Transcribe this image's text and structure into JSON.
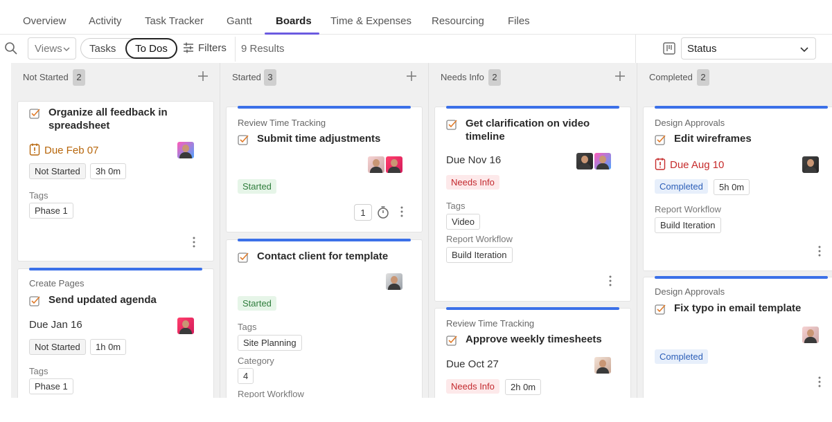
{
  "tabs": [
    "Overview",
    "Activity",
    "Task Tracker",
    "Gantt",
    "Boards",
    "Time & Expenses",
    "Resourcing",
    "Files"
  ],
  "active_tab": "Boards",
  "toolbar": {
    "views_label": "Views",
    "seg_tasks": "Tasks",
    "seg_todos": "To Dos",
    "filters_label": "Filters",
    "results": "9 Results",
    "group_by": "Status"
  },
  "colors": {
    "accent": "#6b5ae0",
    "card_bar": "#3b70e8"
  },
  "columns": [
    {
      "title": "Not Started",
      "count": "2"
    },
    {
      "title": "Started",
      "count": "3"
    },
    {
      "title": "Needs Info",
      "count": "2"
    },
    {
      "title": "Completed",
      "count": "2"
    }
  ],
  "labels": {
    "tags": "Tags",
    "report_workflow": "Report Workflow",
    "category": "Category"
  },
  "cards": {
    "c1": {
      "title": "Organize all feedback in spreadsheet",
      "due": "Due Feb 07",
      "status": "Not Started",
      "time": "3h 0m",
      "tag": "Phase 1"
    },
    "c2": {
      "parent": "Create Pages",
      "title": "Send updated agenda",
      "due": "Due Jan 16",
      "status": "Not Started",
      "time": "1h 0m",
      "tag": "Phase 1"
    },
    "c3": {
      "parent": "Review Time Tracking",
      "title": "Submit time adjustments",
      "status": "Started",
      "comment_count": "1"
    },
    "c4": {
      "title": "Contact client for template",
      "status": "Started",
      "tag": "Site Planning",
      "category": "4"
    },
    "c5": {
      "title": "Get clarification on video timeline",
      "due": "Due Nov 16",
      "status": "Needs Info",
      "tag": "Video",
      "workflow": "Build Iteration"
    },
    "c6": {
      "parent": "Review Time Tracking",
      "title": "Approve weekly timesheets",
      "due": "Due Oct 27",
      "status": "Needs Info",
      "time": "2h 0m"
    },
    "c7": {
      "parent": "Design Approvals",
      "title": "Edit wireframes",
      "due": "Due Aug 10",
      "status": "Completed",
      "time": "5h 0m",
      "workflow": "Build Iteration"
    },
    "c8": {
      "parent": "Design Approvals",
      "title": "Fix typo in email template",
      "status": "Completed"
    }
  },
  "icons": {
    "search": "search-icon",
    "chevron": "chevron-down-icon",
    "filters": "sliders-icon",
    "board": "board-icon",
    "add": "plus-icon",
    "check": "checkbox-icon",
    "due_warning": "alert-icon",
    "more": "more-vertical-icon",
    "timer": "stopwatch-icon"
  }
}
